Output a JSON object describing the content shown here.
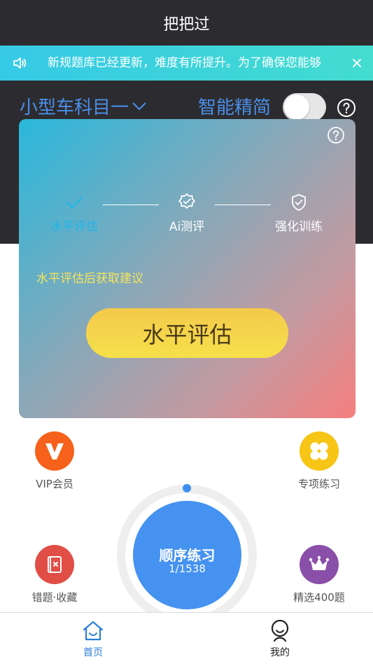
{
  "app": {
    "title": "把把过"
  },
  "notice": {
    "text": "新规题库已经更新，难度有所提升。为了确保您能够",
    "speaker_icon": "speaker-icon",
    "close_icon": "close-icon"
  },
  "header": {
    "subject": "小型车科目一",
    "smart_label": "智能精简",
    "smart_enabled": false
  },
  "card": {
    "steps": [
      {
        "label": "水平评估",
        "icon": "check-icon",
        "active": true
      },
      {
        "label": "Ai测评",
        "icon": "badge-check-icon",
        "active": false
      },
      {
        "label": "强化训练",
        "icon": "shield-check-icon",
        "active": false
      }
    ],
    "advice": "水平评估后获取建议",
    "button_label": "水平评估"
  },
  "features": {
    "vip": {
      "label": "VIP会员",
      "icon": "vip-icon",
      "color": "#f6621b"
    },
    "special": {
      "label": "专项练习",
      "icon": "clover-icon",
      "color": "#f7c516"
    },
    "wrong": {
      "label": "错题·收藏",
      "icon": "wrong-book-icon",
      "color": "#e04e46"
    },
    "selected": {
      "label": "精选400题",
      "icon": "crown-icon",
      "color": "#8a4fa8"
    }
  },
  "practice": {
    "title": "顺序练习",
    "count": "1/1538",
    "progress": 0
  },
  "tabs": [
    {
      "label": "首页",
      "icon": "home-icon",
      "active": true
    },
    {
      "label": "我的",
      "icon": "profile-icon",
      "active": false
    }
  ],
  "colors": {
    "accent": "#4592f1",
    "dark": "#2c2b2f",
    "notice": "#36c9e6"
  }
}
